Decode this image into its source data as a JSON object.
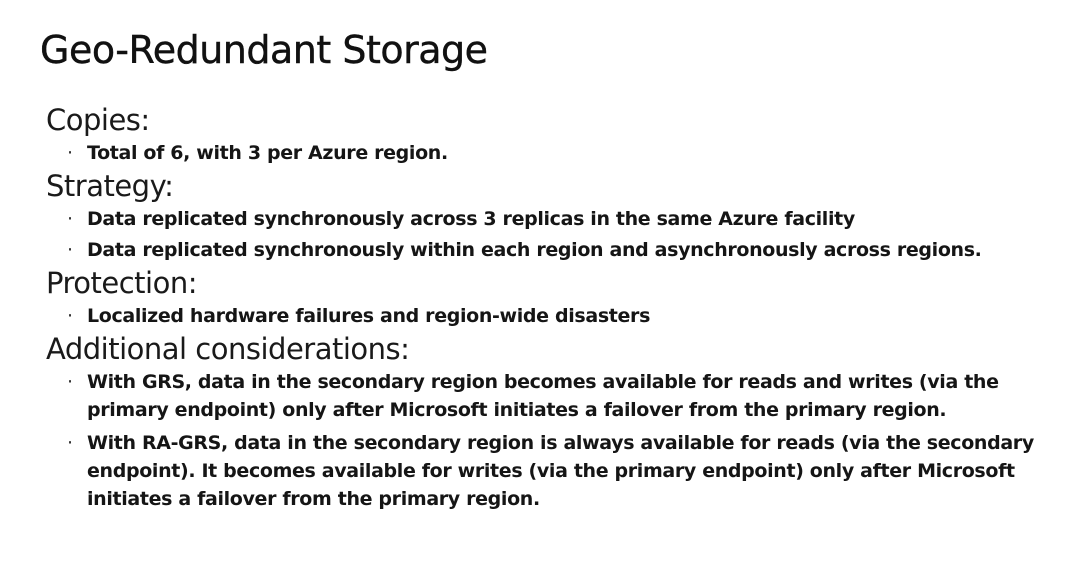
{
  "slide": {
    "title": "Geo-Redundant Storage",
    "sections": [
      {
        "heading": "Copies:",
        "bullets": [
          "Total of 6, with 3 per Azure region."
        ]
      },
      {
        "heading": "Strategy:",
        "bullets": [
          "Data replicated synchronously across 3 replicas in the same Azure facility",
          "Data replicated synchronously within each region and asynchronously across regions."
        ]
      },
      {
        "heading": "Protection:",
        "bullets": [
          "Localized hardware failures and region-wide disasters"
        ]
      },
      {
        "heading": "Additional considerations:",
        "bullets": [
          "With GRS, data in the secondary region becomes available for reads and writes (via the primary endpoint) only after Microsoft initiates a failover from the primary region.",
          "With RA-GRS, data in the secondary region is always available for reads (via the secondary endpoint). It becomes available for writes (via the primary endpoint) only after Microsoft initiates a failover from the primary region."
        ]
      }
    ],
    "bullet_glyph": "·"
  }
}
